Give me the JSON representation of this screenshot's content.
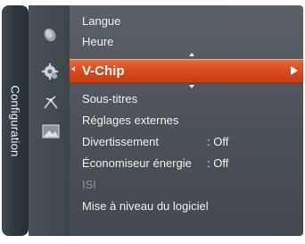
{
  "sidebar": {
    "category_label": "Configuration",
    "icons": [
      "satellite-dish-icon",
      "gear-icon",
      "antenna-icon",
      "picture-icon"
    ]
  },
  "menu": {
    "items": [
      {
        "label": "Langue"
      },
      {
        "label": "Heure"
      },
      {
        "label": "V-Chip",
        "selected": true
      },
      {
        "label": "Sous-titres"
      },
      {
        "label": "Réglages externes"
      },
      {
        "label": "Divertissement",
        "value": ": Off"
      },
      {
        "label": "Économiseur énergie",
        "value": ": Off"
      },
      {
        "label": "ISI",
        "disabled": true
      },
      {
        "label": "Mise à niveau du logiciel"
      }
    ]
  },
  "colors": {
    "selected_bar": "#d94c1f",
    "panel": "#50575c",
    "text": "#f0f0f0",
    "disabled_text": "#8d959a"
  }
}
